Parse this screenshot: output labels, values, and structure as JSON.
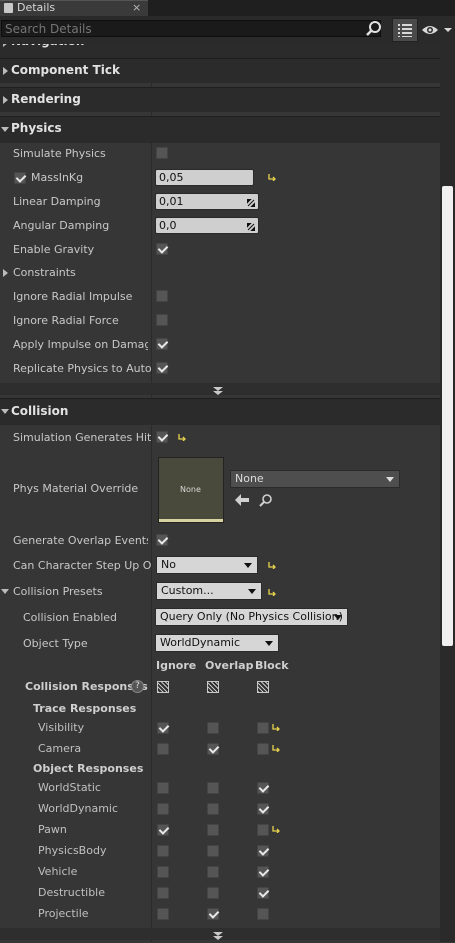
{
  "tab": {
    "label": "Details",
    "close": "×"
  },
  "search": {
    "placeholder": "Search Details"
  },
  "categories": {
    "navigation": "Navigation",
    "component_tick": "Component Tick",
    "rendering": "Rendering",
    "physics": "Physics",
    "collision": "Collision"
  },
  "physics": {
    "simulate_physics": "Simulate Physics",
    "mass_in_kg": "MassInKg",
    "mass_value": "0,05",
    "linear_damping": "Linear Damping",
    "linear_value": "0,01",
    "angular_damping": "Angular Damping",
    "angular_value": "0,0",
    "enable_gravity": "Enable Gravity",
    "constraints": "Constraints",
    "ignore_radial_impulse": "Ignore Radial Impulse",
    "ignore_radial_force": "Ignore Radial Force",
    "apply_impulse": "Apply Impulse on Damage",
    "replicate_physics": "Replicate Physics to Autonomous Proxy"
  },
  "collision": {
    "sim_hit_events": "Simulation Generates Hit Events",
    "phys_material_override": "Phys Material Override",
    "material_thumb": "None",
    "material_value": "None",
    "generate_overlap": "Generate Overlap Events",
    "can_step_up": "Can Character Step Up On",
    "step_up_value": "No",
    "collision_presets": "Collision Presets",
    "presets_value": "Custom...",
    "collision_enabled": "Collision Enabled",
    "collision_enabled_value": "Query Only (No Physics Collision)",
    "object_type": "Object Type",
    "object_type_value": "WorldDynamic",
    "col_ignore": "Ignore",
    "col_overlap": "Overlap",
    "col_block": "Block",
    "responses": "Collision Responses",
    "help": "?",
    "trace_responses": "Trace Responses",
    "object_responses": "Object Responses",
    "trace": [
      {
        "name": "Visibility",
        "ignore": true,
        "overlap": false,
        "block": false,
        "reset": true
      },
      {
        "name": "Camera",
        "ignore": false,
        "overlap": true,
        "block": false,
        "reset": true
      }
    ],
    "objects": [
      {
        "name": "WorldStatic",
        "ignore": false,
        "overlap": false,
        "block": true,
        "reset": false
      },
      {
        "name": "WorldDynamic",
        "ignore": false,
        "overlap": false,
        "block": true,
        "reset": false
      },
      {
        "name": "Pawn",
        "ignore": true,
        "overlap": false,
        "block": false,
        "reset": true
      },
      {
        "name": "PhysicsBody",
        "ignore": false,
        "overlap": false,
        "block": true,
        "reset": false
      },
      {
        "name": "Vehicle",
        "ignore": false,
        "overlap": false,
        "block": true,
        "reset": false
      },
      {
        "name": "Destructible",
        "ignore": false,
        "overlap": false,
        "block": true,
        "reset": false
      },
      {
        "name": "Projectile",
        "ignore": false,
        "overlap": true,
        "block": false,
        "reset": false
      }
    ]
  },
  "colors": {
    "reset_arrow": "#e8d44d",
    "panel": "#363636",
    "category": "#2b2b2b"
  }
}
